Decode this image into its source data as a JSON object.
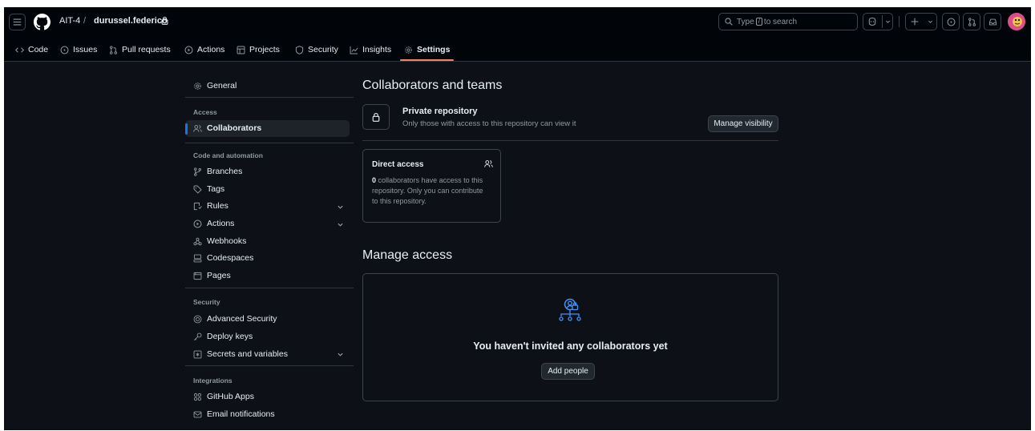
{
  "header": {
    "owner": "AIT-4",
    "separator": "/",
    "repo": "durussel.federico",
    "search": {
      "prefix": "Type",
      "key": "/",
      "suffix": "to search"
    },
    "icons": [
      "hamburger-icon",
      "github-logo",
      "lock-icon",
      "search-icon",
      "copilot-icon",
      "plus-icon",
      "issue-icon",
      "pull-request-icon",
      "inbox-icon",
      "avatar"
    ]
  },
  "tabs": [
    {
      "label": "Code",
      "icon": "code-icon"
    },
    {
      "label": "Issues",
      "icon": "issue-icon"
    },
    {
      "label": "Pull requests",
      "icon": "pull-request-icon"
    },
    {
      "label": "Actions",
      "icon": "play-icon"
    },
    {
      "label": "Projects",
      "icon": "table-icon"
    },
    {
      "label": "Security",
      "icon": "shield-icon"
    },
    {
      "label": "Insights",
      "icon": "graph-icon"
    },
    {
      "label": "Settings",
      "icon": "gear-icon",
      "selected": true
    }
  ],
  "sidebar": {
    "general": "General",
    "access_heading": "Access",
    "collaborators": "Collaborators",
    "code_heading": "Code and automation",
    "branches": "Branches",
    "tags": "Tags",
    "rules": "Rules",
    "actions": "Actions",
    "webhooks": "Webhooks",
    "codespaces": "Codespaces",
    "pages": "Pages",
    "security_heading": "Security",
    "advanced_security": "Advanced Security",
    "deploy_keys": "Deploy keys",
    "secrets": "Secrets and variables",
    "integrations_heading": "Integrations",
    "github_apps": "GitHub Apps",
    "email_notifications": "Email notifications"
  },
  "main": {
    "title": "Collaborators and teams",
    "private_title": "Private repository",
    "private_desc": "Only those with access to this repository can view it",
    "manage_visibility": "Manage visibility",
    "direct_access": {
      "title": "Direct access",
      "count": "0",
      "line1": "collaborators have access to this",
      "line2": "repository. Only you can contribute",
      "line3": "to this repository."
    },
    "manage_access_title": "Manage access",
    "empty_message": "You haven't invited any collaborators yet",
    "add_people": "Add people"
  },
  "colors": {
    "background": "#0d1117",
    "header": "#010409",
    "border": "#3d444d",
    "accent_underline": "#f78166",
    "selected_marker": "#1f6feb",
    "link_blue": "#4493f8",
    "muted_text": "#9198a1"
  }
}
